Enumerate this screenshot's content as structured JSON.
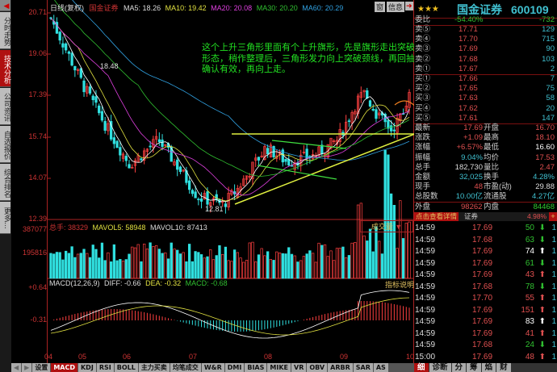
{
  "sidebar": {
    "tabs": [
      "分时走势",
      "技术分析",
      "公司资讯",
      "自选报价",
      "综合排名",
      "更多..."
    ],
    "active": 1
  },
  "chart_header": {
    "period": "日线(复权)",
    "name": "国金证券",
    "ma5": "MA5: 18.26",
    "ma10": "MA10: 19.42",
    "ma20": "MA20: 20.08",
    "ma30": "MA30: 20.20",
    "ma60": "MA60: 20.29",
    "tool_buttons": [
      "窗",
      "信息"
    ]
  },
  "price_axis": [
    "20.71",
    "19.06",
    "17.39",
    "15.74",
    "14.07",
    "12.39"
  ],
  "annotations": {
    "high": "18.48",
    "low": "12.81",
    "note": "这个上升三角形里面有个上升旗形，先是旗形走出突破形态，稍作整理后，三角形发力向上突破颈线，再回抽确认有效，再向上走。"
  },
  "volume": {
    "label_total": "总手: 38329",
    "mavol5": "MAVOL5: 58948",
    "mavol10": "MAVOL10: 87413",
    "axis": [
      "387077",
      "195816"
    ],
    "selector": "成交量"
  },
  "macd": {
    "label": "MACD(12,26,9)",
    "diff": "DIFF: -0.66",
    "dea": "DEA: -0.32",
    "macd": "MACD: -0.68",
    "axis": [
      "+0.64",
      "-0.31"
    ],
    "help": "指标说明"
  },
  "x_axis": [
    "04",
    "05",
    "06",
    "07",
    "08",
    "09",
    "10"
  ],
  "bottom_tabs": [
    "设置",
    "MACD",
    "KDJ",
    "RSI",
    "BOLL",
    "主力买卖",
    "均笔成交",
    "W&R",
    "DMI",
    "BIAS",
    "MIKE",
    "VR",
    "OBV",
    "ARBR",
    "SAR",
    "AS"
  ],
  "chart_data": {
    "type": "candlestick",
    "price_path": [
      [
        0,
        20.5
      ],
      [
        0.03,
        19.6
      ],
      [
        0.09,
        17.8
      ],
      [
        0.16,
        16.0
      ],
      [
        0.22,
        14.6
      ],
      [
        0.3,
        15.6
      ],
      [
        0.36,
        14.4
      ],
      [
        0.41,
        13.3
      ],
      [
        0.48,
        13.0
      ],
      [
        0.52,
        13.6
      ],
      [
        0.6,
        15.3
      ],
      [
        0.66,
        14.7
      ],
      [
        0.74,
        15.0
      ],
      [
        0.8,
        15.6
      ],
      [
        0.87,
        17.6
      ],
      [
        0.91,
        16.6
      ],
      [
        0.95,
        16.0
      ],
      [
        0.985,
        16.7
      ],
      [
        1,
        17.7
      ]
    ],
    "ylim": [
      12.39,
      20.71
    ]
  },
  "quote": {
    "stars": "★★★",
    "name": "国金证券",
    "code": "600109",
    "weibi_label": "委比",
    "weibi": "-54.40%",
    "weicha": "-732",
    "asks": [
      {
        "label": "卖⑤",
        "price": "17.71",
        "vol": "129"
      },
      {
        "label": "卖④",
        "price": "17.70",
        "vol": "715"
      },
      {
        "label": "卖③",
        "price": "17.69",
        "vol": "90"
      },
      {
        "label": "卖②",
        "price": "17.68",
        "vol": "103"
      },
      {
        "label": "卖①",
        "price": "17.67",
        "vol": "2"
      }
    ],
    "bids": [
      {
        "label": "买①",
        "price": "17.66",
        "vol": "7"
      },
      {
        "label": "买②",
        "price": "17.65",
        "vol": "75"
      },
      {
        "label": "买③",
        "price": "17.63",
        "vol": "58"
      },
      {
        "label": "买④",
        "price": "17.62",
        "vol": "20"
      },
      {
        "label": "买⑤",
        "price": "17.61",
        "vol": "147"
      }
    ],
    "stats": [
      [
        "最新",
        "17.69",
        "#e05050",
        "开盘",
        "16.70",
        "#e05050"
      ],
      [
        "涨跌",
        "+1.09",
        "#e05050",
        "最高",
        "18.10",
        "#e05050"
      ],
      [
        "涨幅",
        "+6.57%",
        "#e05050",
        "最低",
        "16.60",
        "#ffffff"
      ],
      [
        "振幅",
        "9.04%",
        "#40c0d0",
        "均价",
        "17.53",
        "#e05050"
      ],
      [
        "总手",
        "182,730",
        "#dddddd",
        "量比",
        "2.47",
        "#e05050"
      ],
      [
        "金额",
        "32,025",
        "#40c0d0",
        "换手",
        "4.28%",
        "#40c0d0"
      ],
      [
        "现手",
        "48",
        "#e05050",
        "市盈(动)",
        "29.88",
        "#dddddd"
      ],
      [
        "总股数",
        "10.00亿",
        "#40c0d0",
        "流通股",
        "4.27亿",
        "#40c0d0"
      ]
    ],
    "outer_label": "外盘",
    "outer": "98262",
    "inner_label": "内盘",
    "inner": "84468"
  },
  "detail": {
    "button": "点击查看详情",
    "sector": "证券",
    "sector_pct": "4.98%",
    "plus": "+",
    "trades": [
      [
        "14:59",
        "17.69",
        "50",
        "down"
      ],
      [
        "14:59",
        "17.68",
        "63",
        "down"
      ],
      [
        "14:59",
        "17.69",
        "74",
        "up-white"
      ],
      [
        "14:59",
        "17.69",
        "61",
        "down"
      ],
      [
        "14:59",
        "17.69",
        "43",
        "up"
      ],
      [
        "14:59",
        "17.68",
        "78",
        "down"
      ],
      [
        "14:59",
        "17.70",
        "55",
        "up"
      ],
      [
        "14:59",
        "17.69",
        "151",
        "up"
      ],
      [
        "14:59",
        "17.69",
        "83",
        "up-white"
      ],
      [
        "14:59",
        "17.69",
        "41",
        "up"
      ],
      [
        "14:59",
        "17.68",
        "24",
        "down"
      ],
      [
        "15:00",
        "17.69",
        "48",
        "up"
      ]
    ],
    "tabs": [
      "细",
      "诊断",
      "分",
      "筹",
      "焰",
      "财"
    ]
  }
}
